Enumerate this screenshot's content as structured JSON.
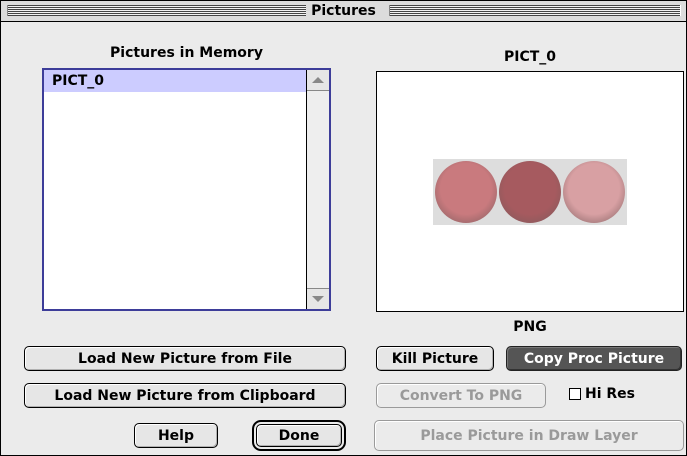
{
  "window": {
    "title": "Pictures"
  },
  "memory": {
    "heading": "Pictures in Memory",
    "items": [
      {
        "label": "PICT_0",
        "selected": true
      }
    ]
  },
  "preview": {
    "name": "PICT_0",
    "format": "PNG",
    "swatch_colors": [
      "#c97a7e",
      "#a65a5f",
      "#d8a0a3"
    ]
  },
  "buttons": {
    "load_file": "Load New Picture from File",
    "load_clipboard": "Load New Picture from Clipboard",
    "help": "Help",
    "done": "Done",
    "kill": "Kill Picture",
    "copy_proc": "Copy Proc Picture",
    "convert_png": "Convert To PNG",
    "place_layer": "Place Picture in Draw Layer"
  },
  "options": {
    "hi_res_label": "Hi Res",
    "hi_res_checked": false
  },
  "icons": {
    "scroll_up": "scroll-up-arrow-icon",
    "scroll_down": "scroll-down-arrow-icon"
  },
  "colors": {
    "selection": "#ccccff",
    "list_focus_border": "#3d3d99",
    "default_button": "#555555"
  }
}
